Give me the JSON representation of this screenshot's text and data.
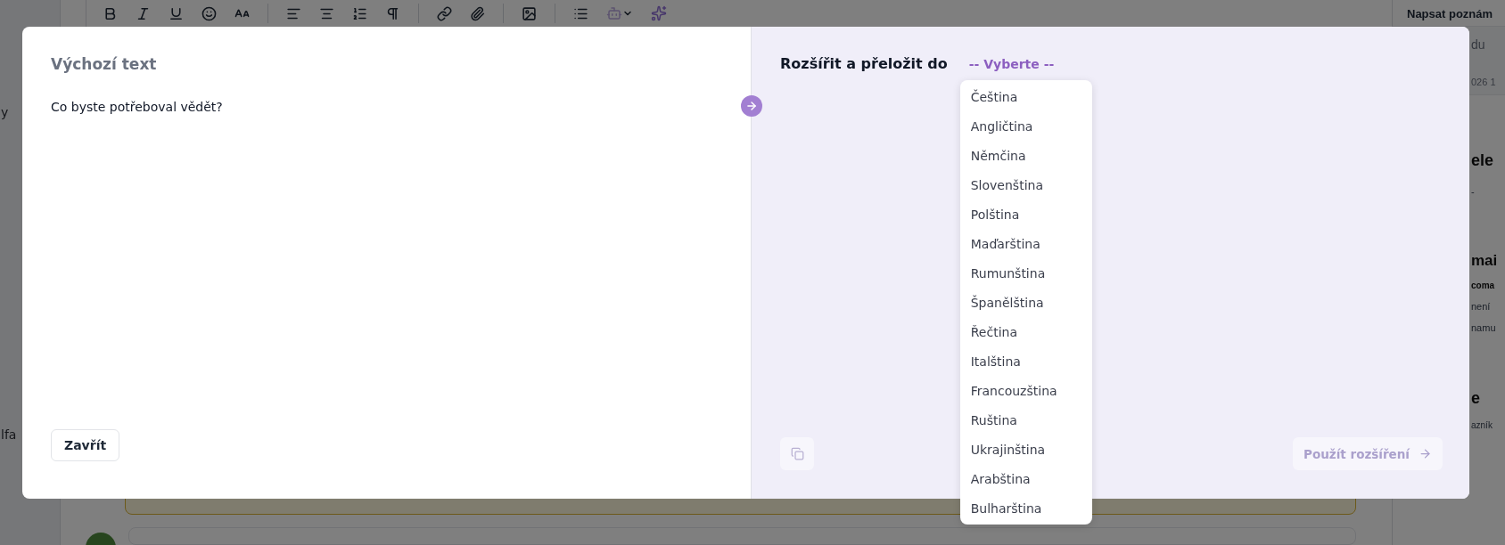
{
  "background": {
    "sidebar": [
      {
        "text": "y"
      },
      {
        "text": "lfa"
      }
    ],
    "notes_panel": {
      "title": "Napsat poznám",
      "fragments": [
        {
          "kind": "field",
          "text": "du"
        },
        {
          "kind": "date",
          "text": "026 1"
        },
        {
          "kind": "big",
          "text": "ele"
        },
        {
          "kind": "text",
          "text": "-"
        },
        {
          "kind": "heading",
          "text": "mai"
        },
        {
          "kind": "bold",
          "text": "coma"
        },
        {
          "kind": "text",
          "text": "není"
        },
        {
          "kind": "text",
          "text": "namu"
        },
        {
          "kind": "big",
          "text": "e"
        },
        {
          "kind": "small",
          "text": "azník"
        }
      ]
    }
  },
  "dialog": {
    "source": {
      "title": "Výchozí text",
      "text": "Co byste potřeboval vědět?",
      "close_button": "Zavřít"
    },
    "target": {
      "label": "Rozšířit a přeložit do",
      "select": {
        "value": "-- Vyberte --",
        "expanded": true,
        "options": [
          {
            "label": "Čeština",
            "selected": false
          },
          {
            "label": "Angličtina",
            "selected": false
          },
          {
            "label": "Němčina",
            "selected": false
          },
          {
            "label": "Slovenština",
            "selected": false
          },
          {
            "label": "Polština",
            "selected": false
          },
          {
            "label": "Maďarština",
            "selected": false
          },
          {
            "label": "Rumunština",
            "selected": false
          },
          {
            "label": "Španělština",
            "selected": false
          },
          {
            "label": "Řečtina",
            "selected": false
          },
          {
            "label": "Italština",
            "selected": false
          },
          {
            "label": "Francouzština",
            "selected": false
          },
          {
            "label": "Ruština",
            "selected": false
          },
          {
            "label": "Ukrajinština",
            "selected": false
          },
          {
            "label": "Arabština",
            "selected": false
          },
          {
            "label": "Bulharština",
            "selected": false
          }
        ]
      },
      "copy_button": {
        "disabled": true
      },
      "apply_button": {
        "label": "Použít rozšíření",
        "disabled": true
      }
    }
  }
}
